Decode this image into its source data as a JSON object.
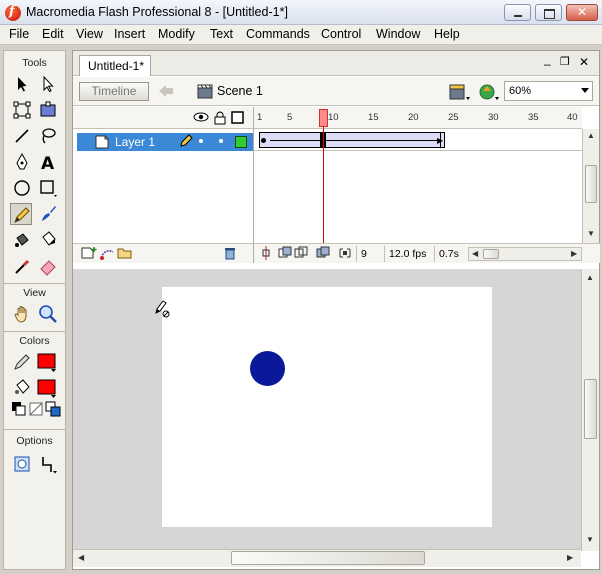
{
  "window": {
    "title": "Macromedia Flash Professional 8 - [Untitled-1*]"
  },
  "menu": {
    "items": [
      "File",
      "Edit",
      "View",
      "Insert",
      "Modify",
      "Text",
      "Commands",
      "Control",
      "Window",
      "Help"
    ]
  },
  "tools_panel": {
    "tools_label": "Tools",
    "view_label": "View",
    "colors_label": "Colors",
    "options_label": "Options",
    "selected_tool": "pencil-tool",
    "stroke_color": "#ff0000",
    "fill_color": "#ff0000"
  },
  "document": {
    "tab_label": "Untitled-1*",
    "timeline_button": "Timeline",
    "scene_label": "Scene 1",
    "zoom": "60%"
  },
  "timeline": {
    "layer_name": "Layer 1",
    "layer_color": "#33cc33",
    "ruler_numbers": [
      "1",
      "5",
      "10",
      "15",
      "20",
      "25",
      "30",
      "35",
      "40"
    ],
    "current_frame": "9",
    "frame_rate": "12.0 fps",
    "elapsed_time": "0.7s"
  },
  "stage": {
    "background": "#ffffff",
    "circle_color": "#0a1999"
  }
}
